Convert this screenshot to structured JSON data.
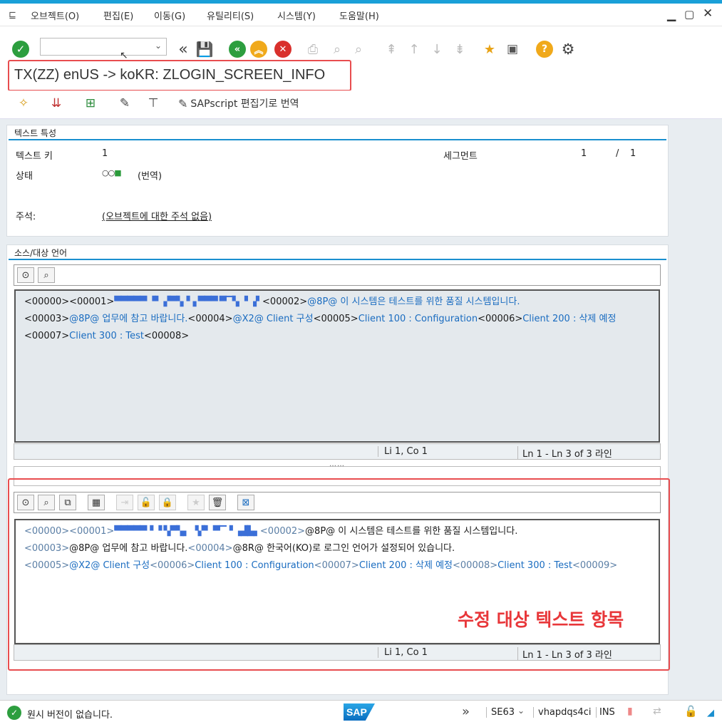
{
  "menu": {
    "items": [
      {
        "label": "오브젝트(O)"
      },
      {
        "label": "편집(E)"
      },
      {
        "label": "이동(G)"
      },
      {
        "label": "유틸리티(S)"
      },
      {
        "label": "시스템(Y)"
      },
      {
        "label": "도움말(H)"
      }
    ]
  },
  "title": "TX(ZZ) enUS -> koKR: ZLOGIN_SCREEN_INFO",
  "app_toolbar": {
    "sapscript_label": "SAPscript 편집기로 번역"
  },
  "text_attributes": {
    "header": "텍스트 특성",
    "text_key_label": "텍스트 키",
    "text_key_value": "1",
    "segment_label": "세그먼트",
    "segment_current": "1",
    "segment_sep": "/",
    "segment_total": "1",
    "status_label": "상태",
    "status_value": "(번역)",
    "comment_label": "주석:",
    "comment_value": "(오브젝트에 대한 주석 없음)"
  },
  "language_section": {
    "header": "소스/대상 언어"
  },
  "source_editor": {
    "lines": [
      [
        {
          "t": "<00000><00001>",
          "c": "b"
        },
        {
          "t": "▀▀▀▀▀ ▝▘ ▞▀▚▝▗ ▀▀▀ ▀▔▚ ▝ ▗▘",
          "c": "blur"
        },
        {
          "t": "<00002>",
          "c": "b"
        },
        {
          "t": "@8P@ 이 시스템은 테스트를 위한 품질 시스템입니다.",
          "c": "c"
        }
      ],
      [
        {
          "t": "<00003>",
          "c": "b"
        },
        {
          "t": "@8P@ 업무에 참고 바랍니다.",
          "c": "c"
        },
        {
          "t": "<00004>",
          "c": "b"
        },
        {
          "t": "@X2@ Client 구성",
          "c": "c"
        },
        {
          "t": "<00005>",
          "c": "b"
        },
        {
          "t": "Client 100 : Configuration",
          "c": "c"
        },
        {
          "t": "<00006>",
          "c": "b"
        },
        {
          "t": "Client 200 : 삭제 예정",
          "c": "c"
        }
      ],
      [
        {
          "t": "<00007>",
          "c": "b"
        },
        {
          "t": "Client 300 : Test",
          "c": "c"
        },
        {
          "t": "<00008>",
          "c": "b"
        }
      ]
    ],
    "status_pos": "Li 1, Co 1",
    "status_lines": "Ln 1 - Ln 3 of 3 라인"
  },
  "target_editor": {
    "lines": [
      [
        {
          "t": "<00000><00001>",
          "c": "g"
        },
        {
          "t": "▀▀▀▀▀▝ ▝ ▚▀▚▖ ▝▞▘ ▀▔▝ ▗▟▙▖",
          "c": "blur"
        },
        {
          "t": "<00002>",
          "c": "g"
        },
        {
          "t": "@8P@ 이 시스템은 테스트를 위한 품질 시스템입니다.",
          "c": "b"
        }
      ],
      [
        {
          "t": "<00003>",
          "c": "g"
        },
        {
          "t": "@8P@ 업무에 참고 바랍니다.",
          "c": "b"
        },
        {
          "t": "<00004>",
          "c": "g"
        },
        {
          "t": "@8R@ 한국어(KO)로 로그인 언어가 설정되어 있습니다.",
          "c": "b"
        }
      ],
      [
        {
          "t": "<00005>",
          "c": "g"
        },
        {
          "t": "@X2@ Client 구성",
          "c": "c"
        },
        {
          "t": "<00006>",
          "c": "g"
        },
        {
          "t": "Client 100 : Configuration",
          "c": "c"
        },
        {
          "t": "<00007>",
          "c": "g"
        },
        {
          "t": "Client 200 : 삭제 예정",
          "c": "c"
        },
        {
          "t": "<00008>",
          "c": "g"
        },
        {
          "t": "Client 300 : Test",
          "c": "c"
        },
        {
          "t": "<00009>",
          "c": "g"
        }
      ]
    ],
    "status_pos": "Li 1, Co 1",
    "status_lines": "Ln 1 - Ln 3 of 3 라인"
  },
  "annotation": "수정 대상 텍스트 항목",
  "statusbar": {
    "message": "원시 버전이 없습니다.",
    "transaction": "SE63",
    "system": "vhapdqs4ci",
    "mode": "INS",
    "logo": "SAP"
  },
  "colors": {
    "accent": "#1aa0d8",
    "highlight": "#e84d4f"
  }
}
